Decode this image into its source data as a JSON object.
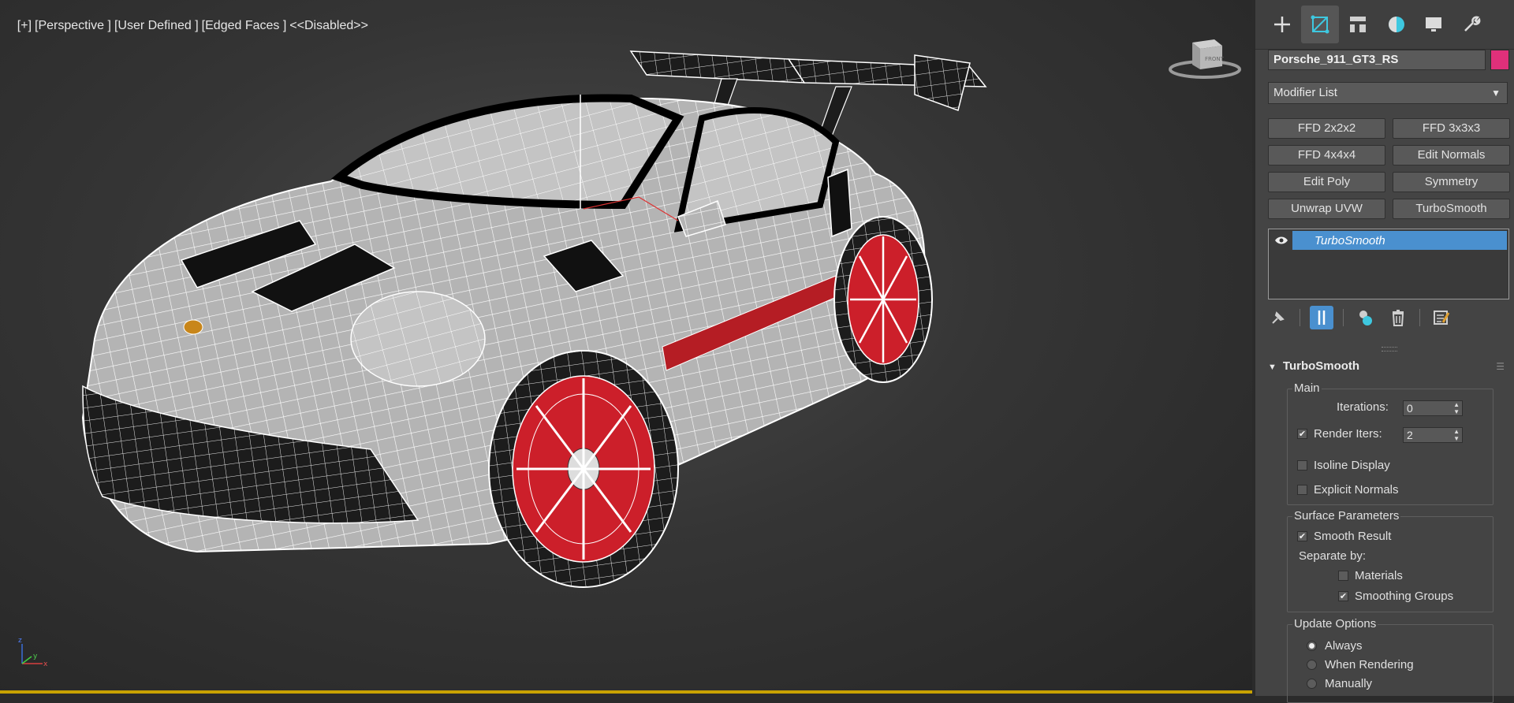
{
  "viewport": {
    "label_parts": [
      "[+]",
      "[Perspective ]",
      "[User Defined ]",
      "[Edged Faces ]",
      "<<Disabled>>"
    ],
    "viewcube_label": "FRONT",
    "axes": {
      "z": "z",
      "y": "y",
      "x": "x"
    }
  },
  "panel": {
    "tabs": [
      {
        "name": "create",
        "icon": "plus-icon"
      },
      {
        "name": "modify",
        "icon": "modify-icon"
      },
      {
        "name": "hierarchy",
        "icon": "hierarchy-icon"
      },
      {
        "name": "motion",
        "icon": "motion-icon"
      },
      {
        "name": "display",
        "icon": "display-icon"
      },
      {
        "name": "utilities",
        "icon": "wrench-icon"
      }
    ],
    "active_tab": "modify",
    "object_name": "Porsche_911_GT3_RS",
    "object_color": "#e0307a",
    "modifier_list_label": "Modifier List",
    "modifier_buttons": [
      "FFD 2x2x2",
      "FFD 3x3x3",
      "FFD 4x4x4",
      "Edit Normals",
      "Edit Poly",
      "Symmetry",
      "Unwrap UVW",
      "TurboSmooth"
    ],
    "stack": {
      "selected": "TurboSmooth"
    },
    "rollout": {
      "title": "TurboSmooth",
      "main": {
        "title": "Main",
        "iterations_label": "Iterations:",
        "iterations_value": "0",
        "render_iters_label": "Render Iters:",
        "render_iters_value": "2",
        "render_iters_checked": true,
        "isoline_label": "Isoline Display",
        "isoline_checked": false,
        "explicit_normals_label": "Explicit Normals",
        "explicit_normals_checked": false
      },
      "surface": {
        "title": "Surface Parameters",
        "smooth_result_label": "Smooth Result",
        "smooth_result_checked": true,
        "separate_by_label": "Separate by:",
        "materials_label": "Materials",
        "materials_checked": false,
        "smoothing_groups_label": "Smoothing Groups",
        "smoothing_groups_checked": true
      },
      "update": {
        "title": "Update Options",
        "options": [
          "Always",
          "When Rendering",
          "Manually"
        ],
        "selected": "Always"
      }
    }
  },
  "colors": {
    "accent_blue": "#4a90cf",
    "viewport_border": "#c8a200",
    "wheel_red": "#cc1f2a"
  }
}
